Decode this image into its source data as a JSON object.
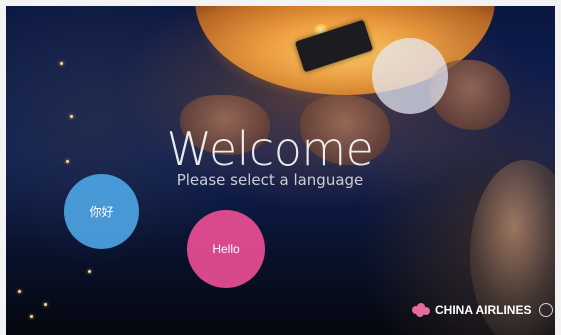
{
  "welcome": {
    "title": "Welcome",
    "subtitle": "Please select a language"
  },
  "languages": [
    {
      "label": "你好"
    },
    {
      "label": "Hello"
    },
    {
      "label": ""
    }
  ],
  "brand": {
    "name": "CHINA AIRLINES"
  },
  "colors": {
    "chinese_bubble": "#50aaeb",
    "english_bubble": "#f05096",
    "extra_bubble": "#e6ebfa",
    "logo_plum": "#e56aa0"
  },
  "icons": [
    "plum-blossom-icon",
    "seal-icon"
  ]
}
